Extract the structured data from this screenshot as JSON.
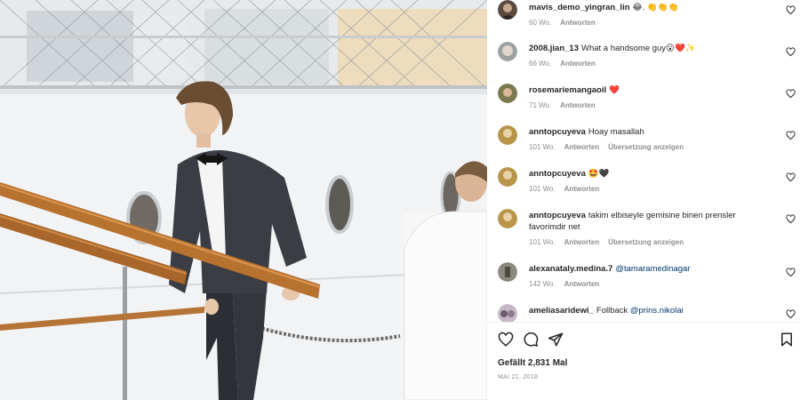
{
  "post": {
    "likes_text": "Gefällt 2,831 Mal",
    "date_text": "MAI 21, 2018"
  },
  "comments": [
    {
      "username": "mavis_demo_yingran_lin",
      "text": "😂. 👏👏👏",
      "time": "60 Wo.",
      "reply": "Antworten",
      "avatar_color": "#5b4a3f"
    },
    {
      "username": "2008.jian_13",
      "text": "What a handsome guy😮❤️✨",
      "time": "66 Wo.",
      "reply": "Antworten",
      "avatar_color": "#9aa3a0"
    },
    {
      "username": "rosemariemangaoil",
      "text": "❤️",
      "time": "71 Wo.",
      "reply": "Antworten",
      "avatar_color": "#7a7a4e"
    },
    {
      "username": "anntopcuyeva",
      "text": "Hoay masallah",
      "time": "101 Wo.",
      "reply": "Antworten",
      "translate": "Übersetzung anzeigen",
      "avatar_color": "#b8954a"
    },
    {
      "username": "anntopcuyeva",
      "text": "🤩🖤",
      "time": "101 Wo.",
      "reply": "Antworten",
      "avatar_color": "#b8954a"
    },
    {
      "username": "anntopcuyeva",
      "text": "takim elbiseyle gemisine binen prensler favorimdir net",
      "time": "101 Wo.",
      "reply": "Antworten",
      "translate": "Übersetzung anzeigen",
      "avatar_color": "#b8954a"
    },
    {
      "username": "alexanataly.medina.7",
      "mention": "@tamaramedinagar",
      "text": "",
      "time": "142 Wo.",
      "reply": "Antworten",
      "avatar_color": "#8c8a7e"
    },
    {
      "username": "ameliasaridewi_",
      "text": "Follback",
      "mention": "@prins.nikolai",
      "time": "",
      "reply": "",
      "avatar_color": "#c7b8c5"
    }
  ],
  "colors": {
    "accent_link": "#00376b",
    "meta_gray": "#8e8e8e",
    "text": "#262626"
  },
  "icons": {
    "like": "heart-outline-icon",
    "comment": "comment-bubble-icon",
    "share": "paper-plane-icon",
    "save": "bookmark-icon"
  }
}
